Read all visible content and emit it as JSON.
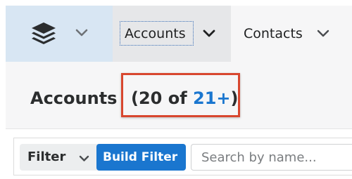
{
  "nav": {
    "home_icon": "stacked-layers-icon",
    "tabs": [
      {
        "label": "Accounts",
        "active": true,
        "icon": "chevron-down-icon"
      },
      {
        "label": "Contacts",
        "active": false,
        "icon": "chevron-down-icon"
      }
    ]
  },
  "header": {
    "title": "Accounts",
    "count_open": "(20 of ",
    "count_total": "21+",
    "count_close": ")"
  },
  "filter": {
    "filter_label": "Filter",
    "build_filter_label": "Build Filter",
    "search_placeholder": "Search by name...",
    "search_value": ""
  },
  "colors": {
    "accent_blue": "#1a76cf",
    "highlight_red": "#d8472f",
    "nav_home_bg": "#d8e6f3"
  }
}
